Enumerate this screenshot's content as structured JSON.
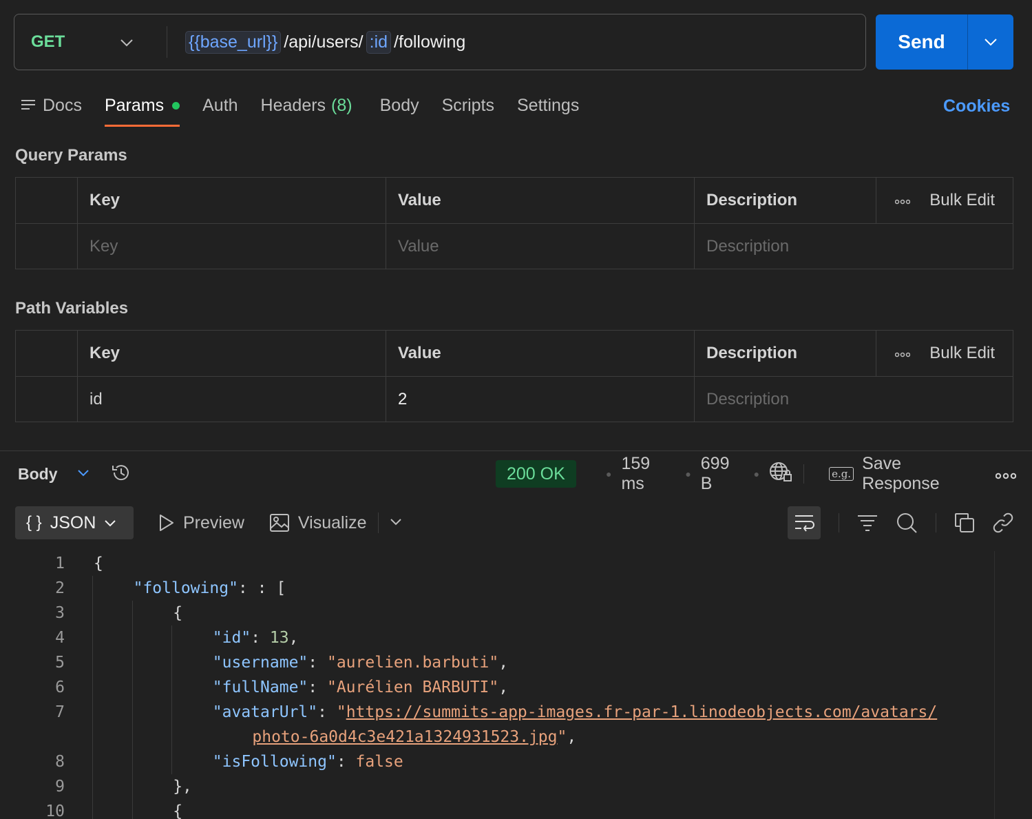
{
  "request": {
    "method": "GET",
    "url_parts": [
      {
        "text": "{{base_url}}",
        "type": "var"
      },
      {
        "text": "/api/users/",
        "type": "text"
      },
      {
        "text": ":id",
        "type": "var"
      },
      {
        "text": "/following",
        "type": "text"
      }
    ],
    "send_label": "Send"
  },
  "tabs": [
    {
      "label": "Docs"
    },
    {
      "label": "Params",
      "active": true
    },
    {
      "label": "Auth"
    },
    {
      "label": "Headers",
      "count": "(8)"
    },
    {
      "label": "Body"
    },
    {
      "label": "Scripts"
    },
    {
      "label": "Settings"
    }
  ],
  "cookies_label": "Cookies",
  "query_params": {
    "title": "Query Params",
    "headers": {
      "key": "Key",
      "value": "Value",
      "description": "Description",
      "bulk": "Bulk Edit"
    },
    "placeholder": {
      "key": "Key",
      "value": "Value",
      "description": "Description"
    }
  },
  "path_variables": {
    "title": "Path Variables",
    "headers": {
      "key": "Key",
      "value": "Value",
      "description": "Description",
      "bulk": "Bulk Edit"
    },
    "row": {
      "key": "id",
      "value": "2",
      "description_placeholder": "Description"
    }
  },
  "response": {
    "body_label": "Body",
    "status": "200 OK",
    "time": "159 ms",
    "size": "699 B",
    "save_label": "Save Response",
    "eg_label": "e.g.",
    "format": "JSON",
    "preview_label": "Preview",
    "visualize_label": "Visualize"
  },
  "colors": {
    "accent": "#ff6c37",
    "send": "#0b6ad6",
    "method": "#6bdd9a",
    "link": "#4c9bff"
  },
  "code_lines": [
    {
      "n": "1",
      "indent": 0,
      "html": "{"
    },
    {
      "n": "2",
      "indent": 1,
      "key": "following",
      "rest": ": ["
    },
    {
      "n": "3",
      "indent": 2,
      "html": "{"
    },
    {
      "n": "4",
      "indent": 3,
      "key": "id",
      "num": "13",
      "rest": ","
    },
    {
      "n": "5",
      "indent": 3,
      "key": "username",
      "str": "aurelien.barbuti",
      "rest": ","
    },
    {
      "n": "6",
      "indent": 3,
      "key": "fullName",
      "str": "Aurélien BARBUTI",
      "rest": ","
    },
    {
      "n": "7",
      "indent": 3,
      "key": "avatarUrl",
      "link1": "https://summits-app-images.fr-par-1.linodeobjects.com/avatars/",
      "link2": "photo-6a0d4c3e421a1324931523.jpg",
      "rest": ","
    },
    {
      "n": "8",
      "indent": 3,
      "key": "isFollowing",
      "bool": "false",
      "rest": ""
    },
    {
      "n": "9",
      "indent": 2,
      "html": "},"
    },
    {
      "n": "10",
      "indent": 2,
      "html": "{"
    }
  ]
}
